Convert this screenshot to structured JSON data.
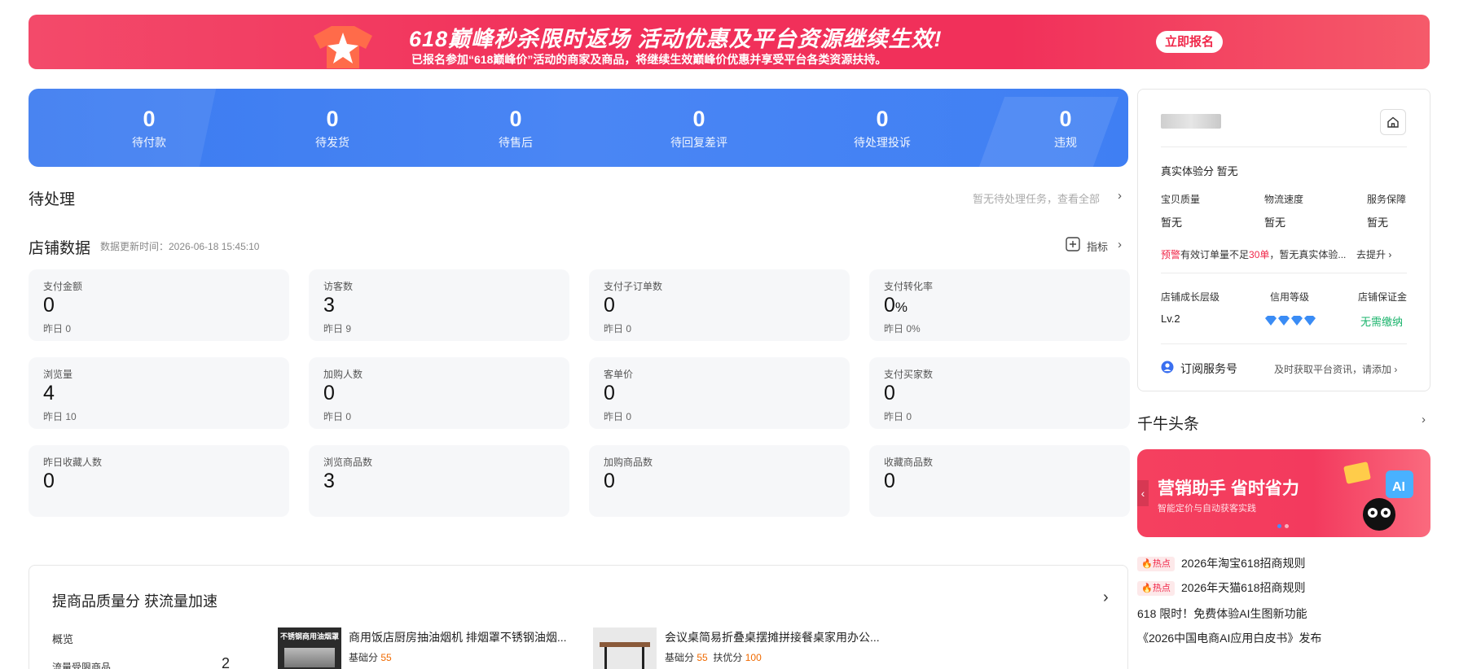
{
  "banner": {
    "title": "618巅峰秒杀限时返场 活动优惠及平台资源继续生效!",
    "subtitle": "已报名参加“618巅峰价”活动的商家及商品，将继续生效巅峰价优惠并享受平台各类资源扶持。",
    "cta": "立即报名"
  },
  "stats": [
    {
      "num": "0",
      "label": "待付款"
    },
    {
      "num": "0",
      "label": "待发货"
    },
    {
      "num": "0",
      "label": "待售后"
    },
    {
      "num": "0",
      "label": "待回复差评"
    },
    {
      "num": "0",
      "label": "待处理投诉"
    },
    {
      "num": "0",
      "label": "违规"
    }
  ],
  "pending": {
    "title": "待处理",
    "right": "暂无待处理任务，查看全部"
  },
  "store": {
    "title": "店铺数据",
    "update": "数据更新时间：2026-06-18 15:45:10",
    "metrics_btn": "指标",
    "cards": [
      {
        "t": "支付金额",
        "v": "0",
        "y": "昨日 0"
      },
      {
        "t": "访客数",
        "v": "3",
        "y": "昨日 9"
      },
      {
        "t": "支付子订单数",
        "v": "0",
        "y": "昨日 0"
      },
      {
        "t": "支付转化率",
        "v": "0",
        "unit": "%",
        "y": "昨日 0%"
      },
      {
        "t": "浏览量",
        "v": "4",
        "y": "昨日 10"
      },
      {
        "t": "加购人数",
        "v": "0",
        "y": "昨日 0"
      },
      {
        "t": "客单价",
        "v": "0",
        "y": "昨日 0"
      },
      {
        "t": "支付买家数",
        "v": "0",
        "y": "昨日 0"
      },
      {
        "t": "昨日收藏人数",
        "v": "0",
        "y": ""
      },
      {
        "t": "浏览商品数",
        "v": "3",
        "y": ""
      },
      {
        "t": "加购商品数",
        "v": "0",
        "y": ""
      },
      {
        "t": "收藏商品数",
        "v": "0",
        "y": ""
      }
    ]
  },
  "right": {
    "exp_label": "真实体验分",
    "exp_value": "暂无",
    "sub": [
      {
        "k": "宝贝质量",
        "v": "暂无"
      },
      {
        "k": "物流速度",
        "v": "暂无"
      },
      {
        "k": "服务保障",
        "v": "暂无"
      }
    ],
    "warn_tag": "预警",
    "warn_a": "有效订单量不足",
    "warn_b": "30单",
    "warn_c": "，暂无真实体验...",
    "improve": "去提升",
    "levels": [
      {
        "k": "店铺成长层级",
        "v": "Lv.2"
      },
      {
        "k": "信用等级",
        "v": ""
      },
      {
        "k": "店铺保证金",
        "v": "无需缴纳"
      }
    ],
    "subscribe": "订阅服务号",
    "subscribe_tip": "及时获取平台资讯，请添加",
    "colors": {
      "warn": "#f0284a",
      "green": "#19b36b",
      "diamond": "#3a8cf5"
    }
  },
  "headlines": {
    "title": "千牛头条",
    "promo_title": "营销助手 省时省力",
    "promo_sub": "智能定价与自动获客实践",
    "items": [
      {
        "hot": "热点",
        "text": "2026年淘宝618招商规则"
      },
      {
        "hot": "热点",
        "text": "2026年天猫618招商规则"
      },
      {
        "hot": "",
        "text": "618 限时！免费体验AI生图新功能"
      },
      {
        "hot": "",
        "text": "《2026中国电商AI应用白皮书》发布"
      }
    ]
  },
  "quality": {
    "title": "提商品质量分 获流量加速",
    "overview": "概览",
    "row_label": "流量受限商品",
    "row_value": "2",
    "products": [
      {
        "name": "商用饭店厨房抽油烟机 排烟罩不锈钢油烟...",
        "score1_label": "基础分",
        "score1": "55",
        "score2_label": "",
        "score2": "",
        "thumb": "不锈钢商用油烟罩"
      },
      {
        "name": "会议桌简易折叠桌摆摊拼接餐桌家用办公...",
        "score1_label": "基础分",
        "score1": "55",
        "score2_label": "扶优分",
        "score2": "100",
        "thumb": ""
      }
    ]
  }
}
